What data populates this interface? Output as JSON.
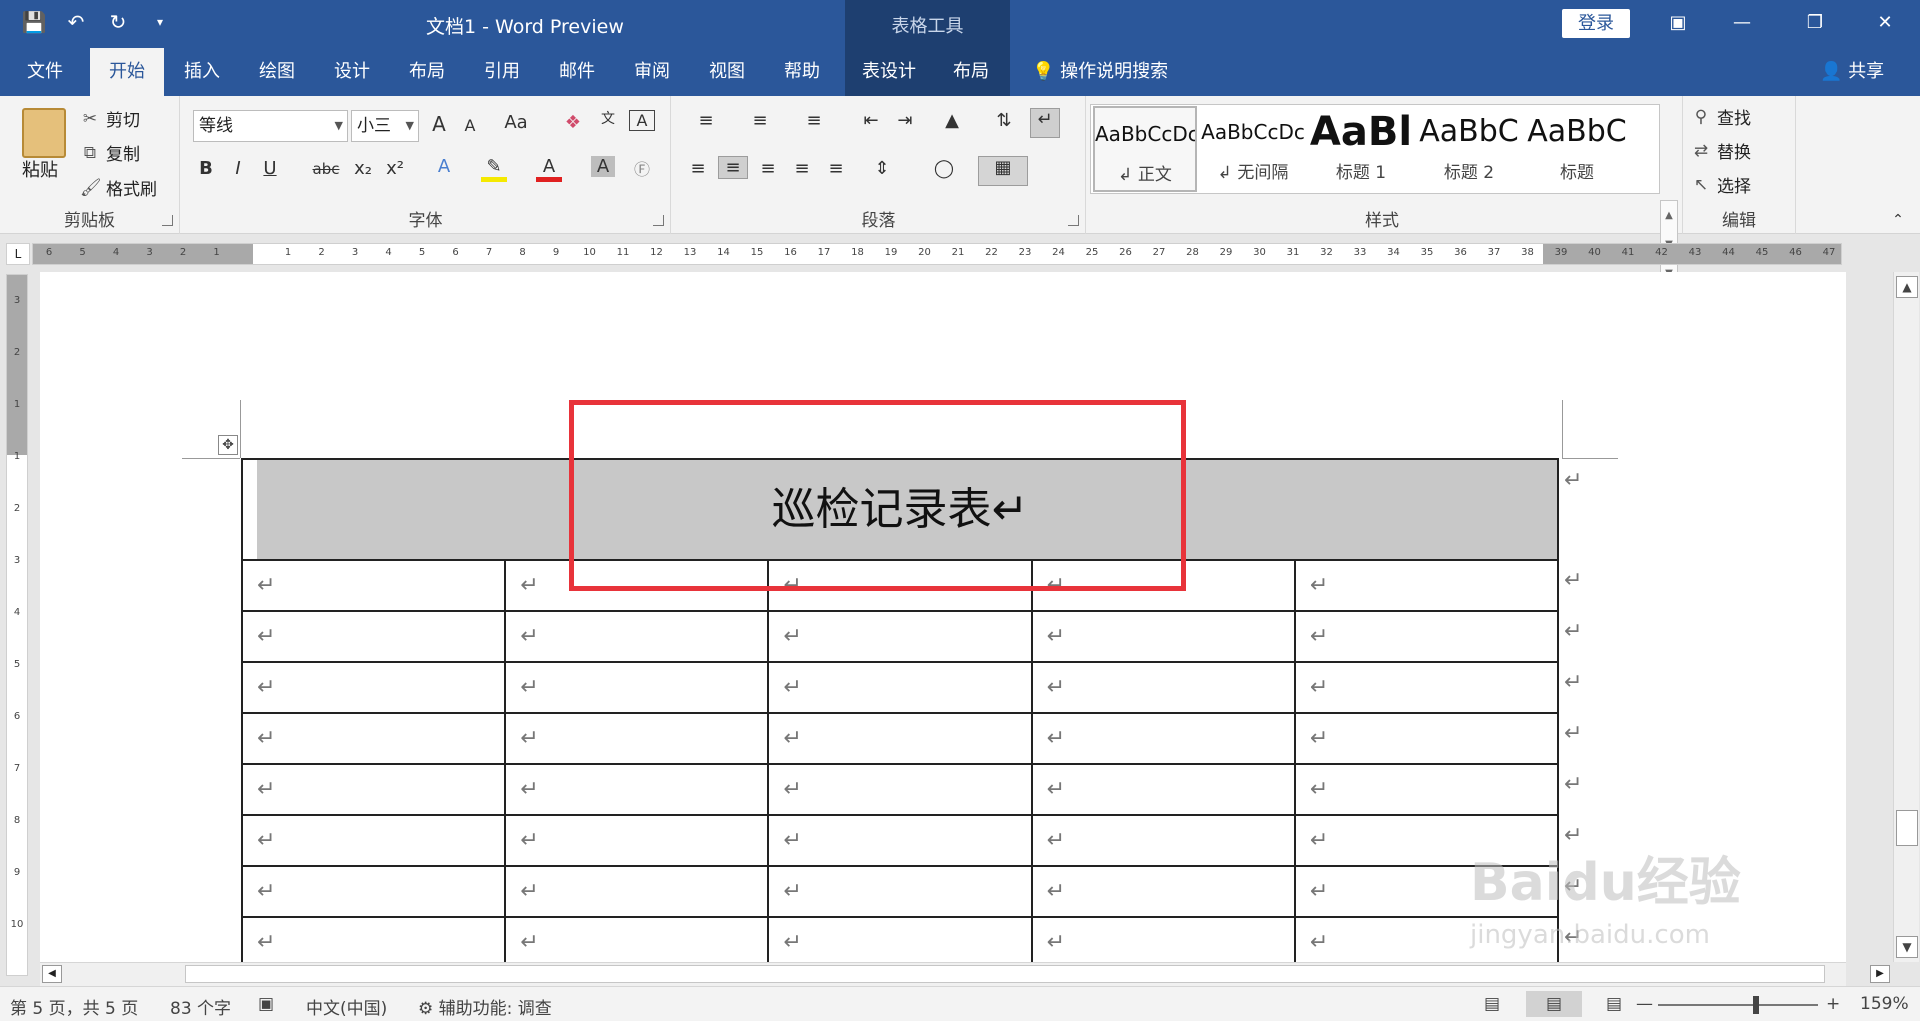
{
  "titlebar": {
    "doc_title": "文档1  -  Word Preview",
    "context_title": "表格工具",
    "login": "登录"
  },
  "tabs": [
    "文件",
    "开始",
    "插入",
    "绘图",
    "设计",
    "布局",
    "引用",
    "邮件",
    "审阅",
    "视图",
    "帮助",
    "表设计",
    "布局"
  ],
  "active_tab": "开始",
  "tell_me": "操作说明搜索",
  "share": "共享",
  "clipboard": {
    "paste": "粘贴",
    "cut": "剪切",
    "copy": "复制",
    "format_painter": "格式刷",
    "label": "剪贴板"
  },
  "font": {
    "name": "等线",
    "size": "小三",
    "label": "字体",
    "grow": "A",
    "shrink": "A",
    "case": "Aa",
    "bold": "B",
    "italic": "I",
    "underline": "U",
    "strike": "abc",
    "sub": "x₂",
    "sup": "x²"
  },
  "paragraph": {
    "label": "段落"
  },
  "styles": {
    "label": "样式",
    "items": [
      {
        "preview": "AaBbCcDc",
        "name": "↲ 正文"
      },
      {
        "preview": "AaBbCcDc",
        "name": "↲ 无间隔"
      },
      {
        "preview": "AaBl",
        "name": "标题 1"
      },
      {
        "preview": "AaBbC",
        "name": "标题 2"
      },
      {
        "preview": "AaBbC",
        "name": "标题"
      }
    ]
  },
  "editing": {
    "find": "查找",
    "replace": "替换",
    "select": "选择",
    "label": "编辑"
  },
  "ruler": {
    "left_marks": [
      "6",
      "5",
      "4",
      "3",
      "2",
      "1"
    ],
    "marks": [
      "1",
      "2",
      "3",
      "4",
      "5",
      "6",
      "7",
      "8",
      "9",
      "10",
      "11",
      "12",
      "13",
      "14",
      "15",
      "16",
      "17",
      "18",
      "19",
      "20",
      "21",
      "22",
      "23",
      "24",
      "25",
      "26",
      "27",
      "28",
      "29",
      "30",
      "31",
      "32",
      "33",
      "34",
      "35",
      "36",
      "37",
      "38",
      "39",
      "40",
      "41",
      "42",
      "43",
      "44",
      "45",
      "46",
      "47"
    ],
    "vmarks": [
      "3",
      "2",
      "1",
      "1",
      "2",
      "3",
      "4",
      "5",
      "6",
      "7",
      "8",
      "9",
      "10"
    ]
  },
  "document": {
    "table_title": "巡检记录表↵",
    "cell_mark": "↵",
    "rows": 8,
    "cols": 5
  },
  "status": {
    "page": "第 5 页，共 5 页",
    "words": "83 个字",
    "language": "中文(中国)",
    "accessibility": "辅助功能: 调查",
    "zoom": "159%"
  },
  "watermark": {
    "brand": "Baidu经验",
    "url": "jingyan.baidu.com"
  }
}
